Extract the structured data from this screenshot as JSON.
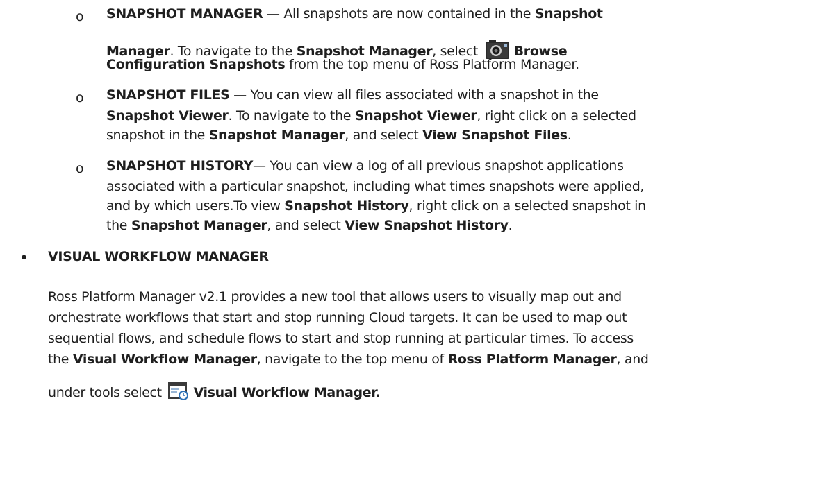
{
  "colors": {
    "text": "#1f1f1f",
    "icon_dark": "#2a2a2a",
    "icon_blue": "#2a6fb5"
  },
  "icons": {
    "snapshot": "camera-icon",
    "workflow": "workflow-window-icon"
  },
  "bullets": {
    "sub": "o",
    "main": "•"
  },
  "items": {
    "snapshot_manager": {
      "label": "SNAPSHOT MANAGER",
      "t1": " — All snapshots are now contained in the ",
      "b1": "Snapshot",
      "b2": "Manager",
      "t2": ". To navigate to the ",
      "b3": "Snapshot Manager",
      "t3": ", select ",
      "b4": "Browse",
      "b5": "Configuration Snapshots",
      "t4": " from the top menu of Ross Platform Manager."
    },
    "snapshot_files": {
      "label": "SNAPSHOT FILES",
      "t1": " — You can view all files associated with a snapshot in the",
      "b1": "Snapshot Viewer",
      "t2": ". To navigate to the ",
      "b2": "Snapshot Viewer",
      "t3": ", right click on a selected",
      "t4": "snapshot in the ",
      "b3": "Snapshot Manager",
      "t5": ", and select ",
      "b4": "View Snapshot Files",
      "t6": "."
    },
    "snapshot_history": {
      "label": "SNAPSHOT HISTORY",
      "t1": "— You can view a log of all previous snapshot applications",
      "t2": "associated with a particular snapshot, including what times snapshots were applied,",
      "t3": "and by which users.To view ",
      "b1": "Snapshot History",
      "t4": ", right click on a selected snapshot in",
      "t5": "the ",
      "b2": "Snapshot Manager",
      "t6": ", and select ",
      "b3": "View Snapshot History",
      "t7": "."
    }
  },
  "visual_workflow": {
    "heading": "VISUAL WORKFLOW MANAGER",
    "l1": "Ross Platform Manager v2.1 provides a new tool that allows users to visually map out and",
    "l2": "orchestrate workflows that start and stop running Cloud targets. It can be used to map out",
    "l3": "sequential flows, and schedule flows to start and stop running at particular times. To access",
    "l4a": "the ",
    "l4b": "Visual Workflow Manager",
    "l4c": ", navigate to the top menu of ",
    "l4d": "Ross Platform Manager",
    "l4e": ", and",
    "l5a": "under tools select ",
    "l5b": "Visual Workflow Manager."
  }
}
